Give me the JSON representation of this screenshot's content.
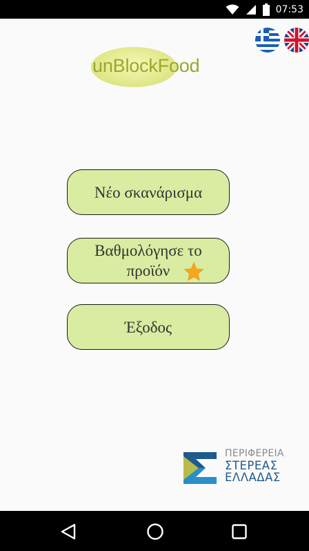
{
  "status_bar": {
    "time": "07:53",
    "icons": [
      "wifi-icon",
      "signal-icon",
      "battery-icon"
    ]
  },
  "language": {
    "options": [
      "greek-flag-icon",
      "uk-flag-icon"
    ]
  },
  "logo": {
    "text": "unBlockFood",
    "accent_color": "#9aa72a"
  },
  "menu": {
    "scan_label": "Νέο σκανάρισμα",
    "rate_label_line1": "Βαθμολόγησε το",
    "rate_label_line2": "προϊόν",
    "exit_label": "Έξοδος",
    "button_color": "#d9eca1"
  },
  "region": {
    "line1": "ΠΕΡΙΦΕΡΕΙΑ",
    "line2": "ΣΤΕΡΕΑΣ",
    "line3": "ΕΛΛΑΔΑΣ"
  },
  "nav_bar": {
    "icons": [
      "back-icon",
      "home-icon",
      "recents-icon"
    ]
  }
}
